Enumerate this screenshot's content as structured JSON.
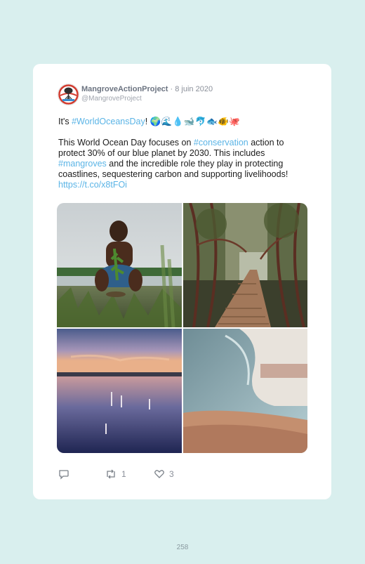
{
  "tweet": {
    "author_name": "MangroveActionProject",
    "separator": " · ",
    "date": "8 juin 2020",
    "handle": "@MangroveProject",
    "line1_prefix": "It's ",
    "line1_hashtag": "#WorldOceansDay",
    "line1_suffix": "!",
    "emojis": "🌍🌊💧🐋🐬🐟🐠🐙",
    "p2_a": "This World Ocean Day focuses on ",
    "p2_hashtag1": "#conservation",
    "p2_b": " action to protect 30% of our blue planet by 2030. This includes ",
    "p2_hashtag2": "#mangroves",
    "p2_c": " and the incredible role they play in protecting coastlines, sequestering carbon and supporting livelihoods!",
    "p2_link": "https://t.co/x8tFOi"
  },
  "actions": {
    "reply_count": "",
    "retweet_count": "1",
    "like_count": "3"
  },
  "page_number": "258",
  "colors": {
    "link": "#5ab4e6",
    "background": "#d9efee",
    "card": "#ffffff"
  },
  "icons": {
    "reply": "reply-icon",
    "retweet": "retweet-icon",
    "like": "heart-icon",
    "avatar": "mangrove-logo-icon"
  }
}
